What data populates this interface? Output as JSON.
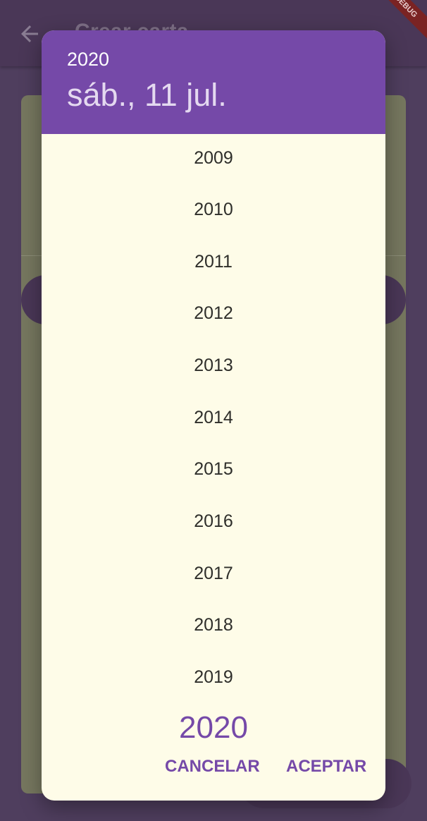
{
  "app": {
    "title": "Crear carta",
    "debug_banner": "DEBUG"
  },
  "date_picker": {
    "header_year": "2020",
    "header_date": "sáb., 11 jul.",
    "years": [
      "2009",
      "2010",
      "2011",
      "2012",
      "2013",
      "2014",
      "2015",
      "2016",
      "2017",
      "2018",
      "2019"
    ],
    "selected_year": "2020",
    "cancel_label": "CANCELAR",
    "accept_label": "ACEPTAR"
  },
  "colors": {
    "primary": "#7549a8",
    "dialog_bg": "#fefce8",
    "scrim_bg": "#4f3e5e"
  },
  "icons": {
    "back": "arrow-left-icon"
  }
}
